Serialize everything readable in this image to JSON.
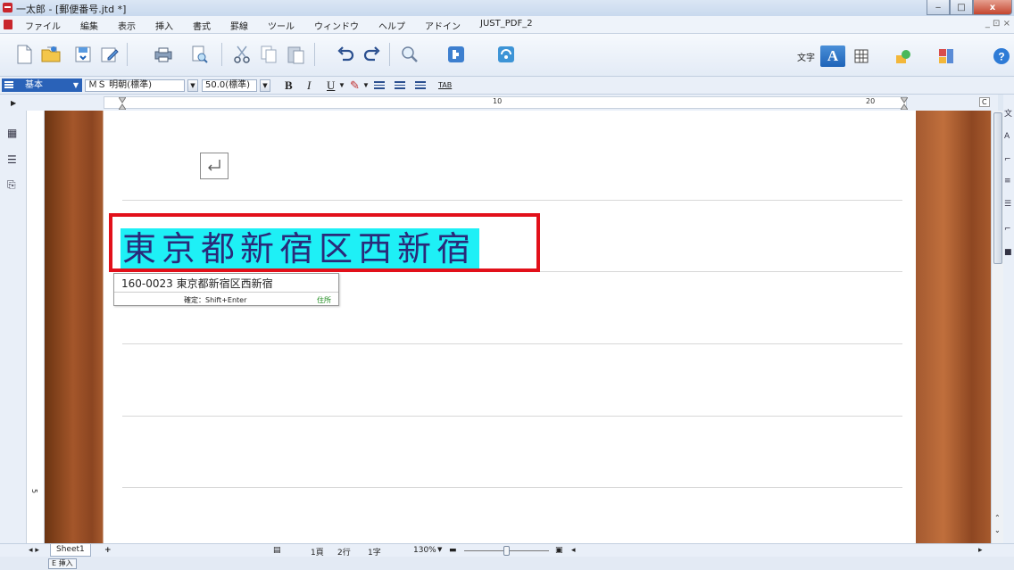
{
  "window": {
    "title": "一太郎 - [郵便番号.jtd *]",
    "min": "‒",
    "max": "□",
    "close": "x"
  },
  "menu": {
    "items": [
      "ファイル",
      "編集",
      "表示",
      "挿入",
      "書式",
      "罫線",
      "ツール",
      "ウィンドウ",
      "ヘルプ",
      "アドイン",
      "JUST_PDF_2"
    ],
    "right": "_ ⊡ ×"
  },
  "toolbar": {
    "char_label": "文字",
    "mode_text": "A"
  },
  "format": {
    "style": "基本",
    "font": "ＭＳ 明朝(標準)",
    "size": "50.0(標準)",
    "bold": "B",
    "italic": "I",
    "underline": "U",
    "tab": "TAB"
  },
  "ruler": {
    "mark_10": "10",
    "mark_20": "20",
    "right_mark": "C"
  },
  "document": {
    "converted_text": "東京都新宿区西新宿",
    "ime_candidate": "160-0023 東京都新宿区西新宿",
    "ime_hint": "確定：Shift+Enter",
    "ime_tag": "住所"
  },
  "vruler": {
    "mark_5": "5"
  },
  "status": {
    "sheet": "Sheet1",
    "page": "1頁",
    "line": "2行",
    "char": "1字",
    "zoom": "130%",
    "mode": "挿入"
  },
  "colors": {
    "highlight": "#1ef0f6",
    "frame": "#e2101a",
    "accent": "#1e63b8"
  }
}
